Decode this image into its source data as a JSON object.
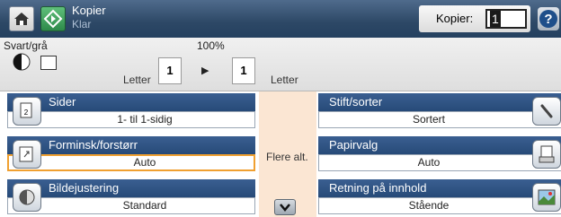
{
  "header": {
    "title": "Kopier",
    "status": "Klar",
    "copies_label": "Kopier:",
    "copies_value": "1"
  },
  "strip": {
    "mode_label": "Svart/grå",
    "zoom": "100%",
    "input_copies": "1",
    "output_copies": "1",
    "paper_in": "Letter",
    "paper_out": "Letter"
  },
  "center": {
    "more_label": "Flere alt."
  },
  "options": {
    "sides": {
      "title": "Sider",
      "value": "1- til 1-sidig"
    },
    "reduce": {
      "title": "Forminsk/forstørr",
      "value": "Auto"
    },
    "image": {
      "title": "Bildejustering",
      "value": "Standard"
    },
    "staple": {
      "title": "Stift/sorter",
      "value": "Sortert"
    },
    "paper": {
      "title": "Papirvalg",
      "value": "Auto"
    },
    "orientation": {
      "title": "Retning på innhold",
      "value": "Stående"
    }
  },
  "colors": {
    "header_bg": "#2d4866",
    "option_title_bg": "#2d5283",
    "center_bg": "#fbe6d3",
    "start_green": "#2e8a4a",
    "selected_outline": "#f0a030"
  },
  "icons": [
    "home-icon",
    "start-copy-icon",
    "help-icon",
    "darkness-icon",
    "document-icon",
    "arrow-right-icon",
    "scroll-down-icon",
    "sides-icon",
    "reduce-enlarge-icon",
    "image-adjust-icon",
    "staple-icon",
    "paper-tray-icon",
    "orientation-icon"
  ]
}
